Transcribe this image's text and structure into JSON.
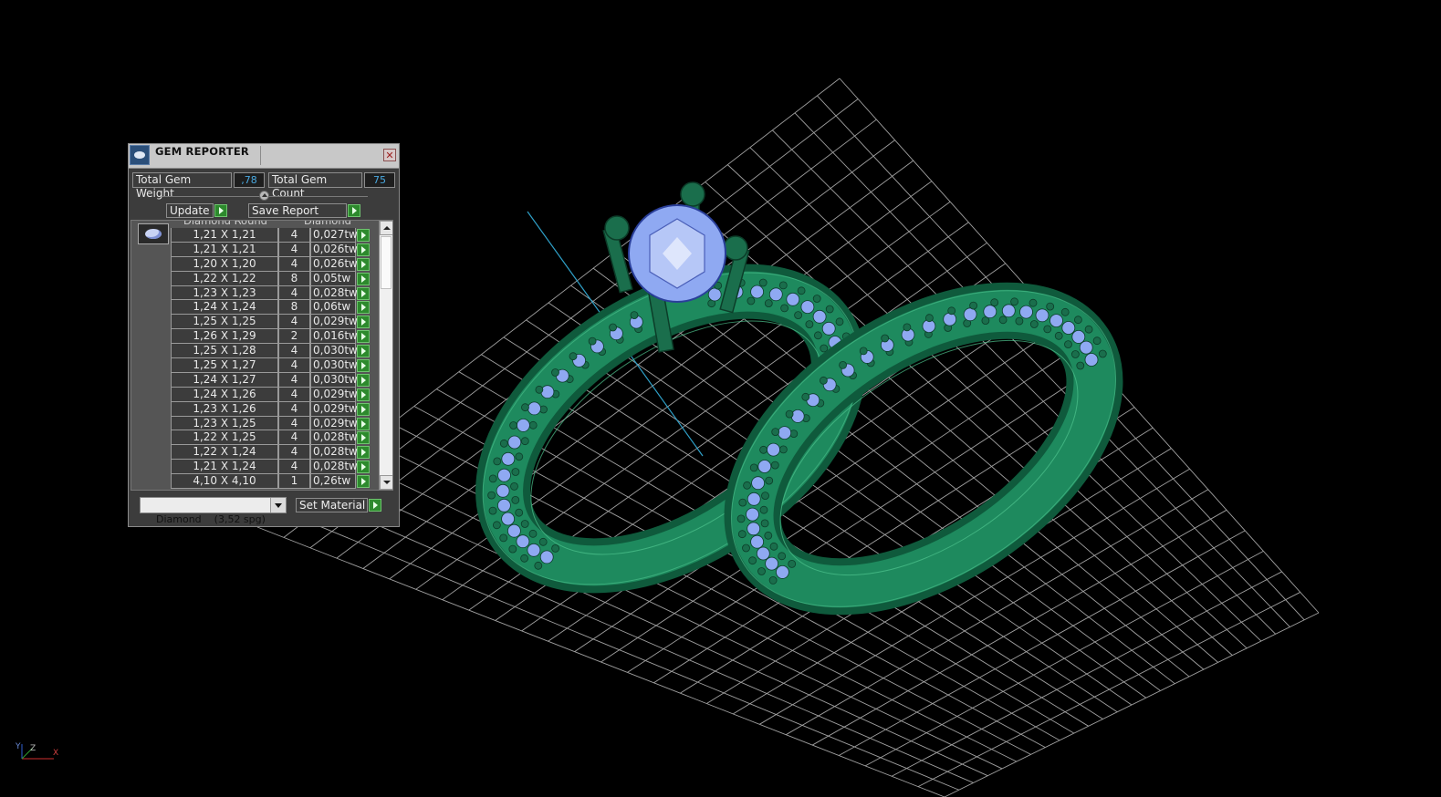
{
  "window": {
    "title": "GEM REPORTER"
  },
  "stats": {
    "weight_label": "Total Gem Weight",
    "weight_value": ",78",
    "count_label": "Total Gem Count",
    "count_value": "75"
  },
  "buttons": {
    "update_label": "Update",
    "save_report_label": "Save Report",
    "set_material_label": "Set Material"
  },
  "table": {
    "columns": [
      "Diamond Round",
      "Diamond"
    ],
    "rows": [
      {
        "size": "1,21 X 1,21",
        "count": "4",
        "weight": "0,027tw"
      },
      {
        "size": "1,21 X 1,21",
        "count": "4",
        "weight": "0,026tw"
      },
      {
        "size": "1,20 X 1,20",
        "count": "4",
        "weight": "0,026tw"
      },
      {
        "size": "1,22 X 1,22",
        "count": "8",
        "weight": "0,05tw"
      },
      {
        "size": "1,23 X 1,23",
        "count": "4",
        "weight": "0,028tw"
      },
      {
        "size": "1,24 X 1,24",
        "count": "8",
        "weight": "0,06tw"
      },
      {
        "size": "1,25 X 1,25",
        "count": "4",
        "weight": "0,029tw"
      },
      {
        "size": "1,26 X 1,29",
        "count": "2",
        "weight": "0,016tw"
      },
      {
        "size": "1,25 X 1,28",
        "count": "4",
        "weight": "0,030tw"
      },
      {
        "size": "1,25 X 1,27",
        "count": "4",
        "weight": "0,030tw"
      },
      {
        "size": "1,24 X 1,27",
        "count": "4",
        "weight": "0,030tw"
      },
      {
        "size": "1,24 X 1,26",
        "count": "4",
        "weight": "0,029tw"
      },
      {
        "size": "1,23 X 1,26",
        "count": "4",
        "weight": "0,029tw"
      },
      {
        "size": "1,23 X 1,25",
        "count": "4",
        "weight": "0,029tw"
      },
      {
        "size": "1,22 X 1,25",
        "count": "4",
        "weight": "0,028tw"
      },
      {
        "size": "1,22 X 1,24",
        "count": "4",
        "weight": "0,028tw"
      },
      {
        "size": "1,21 X 1,24",
        "count": "4",
        "weight": "0,028tw"
      },
      {
        "size": "4,10 X 4,10",
        "count": "1",
        "weight": "0,26tw"
      }
    ]
  },
  "material_select": {
    "value": "Diamond    (3,52 spg)"
  },
  "axis_indicator": {
    "y_label": "Y",
    "z_label": "Z",
    "x_label": "X"
  },
  "colors": {
    "metal": "#1e8a5e",
    "gem": "#8fa9f2",
    "grid": "#c8c8c8",
    "axis_line": "#2fa0c8",
    "accent_value": "#4aa9e0",
    "button_play": "#2d8a2d"
  },
  "icons": [
    "gem-reporter-app-icon",
    "close-icon",
    "play-icon",
    "splitter-toggle-icon",
    "scroll-up-icon",
    "scroll-down-icon",
    "dropdown-arrow-icon",
    "gem-thumbnail-icon",
    "axis-triad-icon"
  ]
}
